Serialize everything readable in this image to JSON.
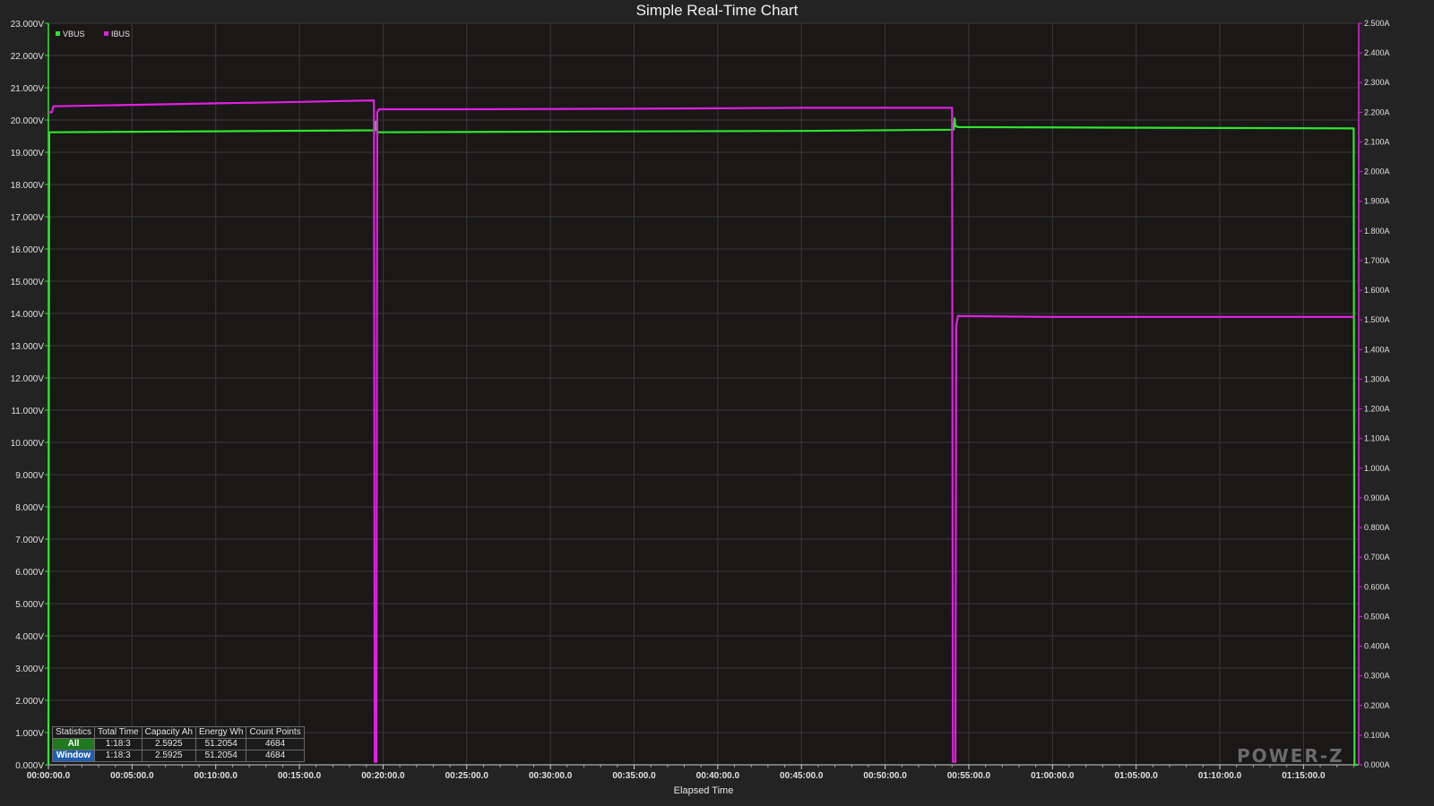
{
  "chart_data": {
    "type": "line",
    "title": "Simple Real-Time Chart",
    "xlabel": "Elapsed Time",
    "x_unit": "minutes",
    "xlim": [
      0,
      78.3
    ],
    "x_ticks": [
      "00:00:00.0",
      "00:05:00.0",
      "00:10:00.0",
      "00:15:00.0",
      "00:20:00.0",
      "00:25:00.0",
      "00:30:00.0",
      "00:35:00.0",
      "00:40:00.0",
      "00:45:00.0",
      "00:50:00.0",
      "00:55:00.0",
      "01:00:00.0",
      "01:05:00.0",
      "01:10:00.0",
      "01:15:00.0"
    ],
    "y_left": {
      "ylim": [
        0,
        23
      ],
      "ticks": [
        "0.000V",
        "1.000V",
        "2.000V",
        "3.000V",
        "4.000V",
        "5.000V",
        "6.000V",
        "7.000V",
        "8.000V",
        "9.000V",
        "10.000V",
        "11.000V",
        "12.000V",
        "13.000V",
        "14.000V",
        "15.000V",
        "16.000V",
        "17.000V",
        "18.000V",
        "19.000V",
        "20.000V",
        "21.000V",
        "22.000V",
        "23.000V"
      ],
      "color": "#2ee62e"
    },
    "y_right": {
      "ylim": [
        0,
        2.5
      ],
      "ticks": [
        "0.000A",
        "0.100A",
        "0.200A",
        "0.300A",
        "0.400A",
        "0.500A",
        "0.600A",
        "0.700A",
        "0.800A",
        "0.900A",
        "1.000A",
        "1.100A",
        "1.200A",
        "1.300A",
        "1.400A",
        "1.500A",
        "1.600A",
        "1.700A",
        "1.800A",
        "1.900A",
        "2.000A",
        "2.100A",
        "2.200A",
        "2.300A",
        "2.400A",
        "2.500A"
      ],
      "color": "#e020e0"
    },
    "grid": true,
    "legend_position": "top-left",
    "series": [
      {
        "name": "VBUS",
        "axis": "left",
        "color": "#2ee62e",
        "x": [
          0,
          0.05,
          10,
          19.5,
          19.55,
          19.6,
          19.7,
          30,
          45,
          54.1,
          54.15,
          54.2,
          54.35,
          65,
          78.0,
          78.05,
          78.2
        ],
        "y": [
          0.0,
          19.62,
          19.65,
          19.68,
          19.95,
          19.68,
          19.62,
          19.64,
          19.66,
          19.7,
          20.05,
          19.82,
          19.78,
          19.76,
          19.74,
          0.0,
          0.0
        ]
      },
      {
        "name": "IBUS",
        "axis": "right",
        "color": "#e020e0",
        "x": [
          0,
          0.2,
          0.3,
          5,
          10,
          15,
          19.4,
          19.45,
          19.5,
          19.6,
          19.65,
          19.75,
          25,
          35,
          45,
          54.0,
          54.05,
          54.1,
          54.2,
          54.25,
          54.35,
          60,
          70,
          78.0
        ],
        "y": [
          2.2,
          2.2,
          2.22,
          2.225,
          2.23,
          2.235,
          2.24,
          2.24,
          0.01,
          0.01,
          2.2,
          2.21,
          2.21,
          2.212,
          2.215,
          2.215,
          0.01,
          0.01,
          0.01,
          1.48,
          1.513,
          1.51,
          1.51,
          1.51
        ]
      }
    ],
    "legend": [
      {
        "name": "VBUS",
        "color": "#2ee62e"
      },
      {
        "name": "IBUS",
        "color": "#e020e0"
      }
    ]
  },
  "stats": {
    "headers": [
      "Statistics",
      "Total Time",
      "Capacity Ah",
      "Energy Wh",
      "Count Points"
    ],
    "rows": [
      {
        "label": "All",
        "values": [
          "1:18:3",
          "2.5925",
          "51.2054",
          "4684"
        ]
      },
      {
        "label": "Window",
        "values": [
          "1:18:3",
          "2.5925",
          "51.2054",
          "4684"
        ]
      }
    ]
  },
  "watermark": "POWER-Z"
}
